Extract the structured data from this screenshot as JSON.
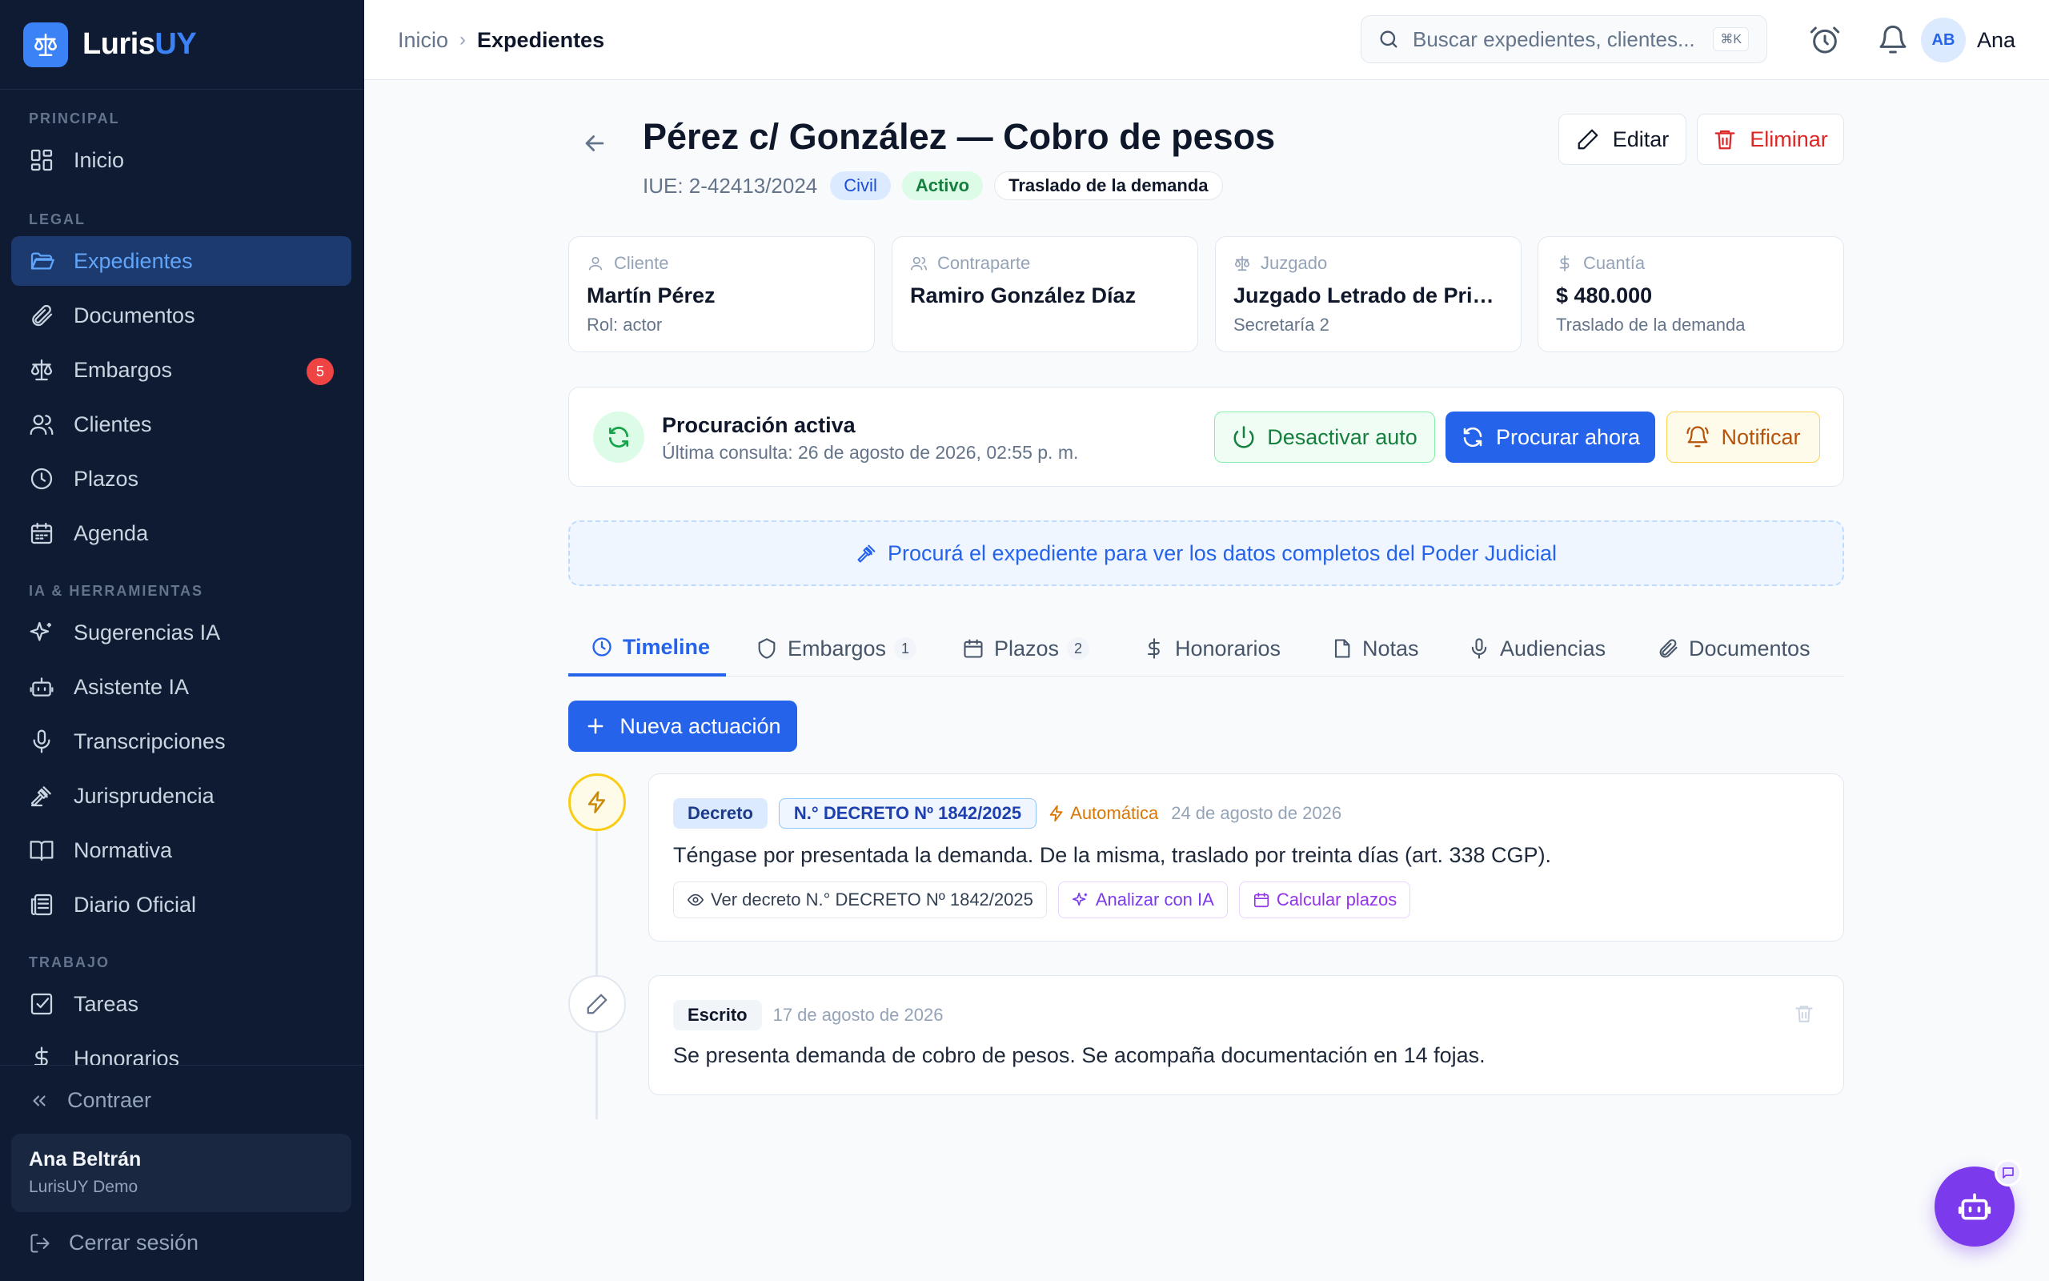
{
  "app": {
    "name_main": "Luris",
    "name_accent": "UY",
    "accent_color": "#3b82f6",
    "sidebar_bg": "#0f1b33"
  },
  "sidebar": {
    "sections": {
      "principal": "PRINCIPAL",
      "legal": "LEGAL",
      "ia": "IA & HERRAMIENTAS",
      "trabajo": "TRABAJO"
    },
    "items": {
      "inicio": "Inicio",
      "expedientes": "Expedientes",
      "documentos": "Documentos",
      "embargos": "Embargos",
      "embargos_badge": "5",
      "clientes": "Clientes",
      "plazos": "Plazos",
      "agenda": "Agenda",
      "sugerencias": "Sugerencias IA",
      "asistente": "Asistente IA",
      "transcripciones": "Transcripciones",
      "jurisprudencia": "Jurisprudencia",
      "normativa": "Normativa",
      "diario": "Diario Oficial",
      "tareas": "Tareas",
      "honorarios": "Honorarios"
    },
    "collapse_label": "Contraer",
    "user": {
      "name": "Ana Beltrán",
      "org": "LurisUY Demo"
    },
    "logout_label": "Cerrar sesión"
  },
  "topbar": {
    "breadcrumb": [
      "Inicio",
      "Expedientes"
    ],
    "search_placeholder": "Buscar expedientes, clientes...",
    "search_shortcut": "⌘K",
    "avatar_initials": "AB",
    "user_name": "Ana"
  },
  "case": {
    "title": "Pérez c/ González — Cobro de pesos",
    "iue": "IUE: 2-42413/2024",
    "materia": "Civil",
    "status": "Activo",
    "etapa": "Traslado de la demanda",
    "edit_label": "Editar",
    "delete_label": "Eliminar"
  },
  "info_cards": {
    "cliente": {
      "label": "Cliente",
      "value": "Martín Pérez",
      "sub": "Rol: actor"
    },
    "contraparte": {
      "label": "Contraparte",
      "value": "Ramiro González Díaz",
      "sub": ""
    },
    "juzgado": {
      "label": "Juzgado",
      "value": "Juzgado Letrado de Prime...",
      "sub": "Secretaría 2"
    },
    "cuantia": {
      "label": "Cuantía",
      "value": "$ 480.000",
      "sub": "Traslado de la demanda"
    }
  },
  "procuracion": {
    "title": "Procuración activa",
    "last_check": "Última consulta: 26 de agosto de 2026, 02:55 p. m.",
    "deactivate_label": "Desactivar auto",
    "procure_label": "Procurar ahora",
    "notify_label": "Notificar"
  },
  "hint": "Procurá el expediente para ver los datos completos del Poder Judicial",
  "tabs": {
    "timeline": "Timeline",
    "embargos": "Embargos",
    "embargos_count": "1",
    "plazos": "Plazos",
    "plazos_count": "2",
    "honorarios": "Honorarios",
    "notas": "Notas",
    "audiencias": "Audiencias",
    "documentos": "Documentos"
  },
  "new_action_label": "Nueva actuación",
  "actuaciones": [
    {
      "type": "Decreto",
      "number": "N.° DECRETO Nº 1842/2025",
      "origin": "Automática",
      "date": "24 de agosto de 2026",
      "text": "Téngase por presentada la demanda. De la misma, traslado por treinta días (art. 338 CGP).",
      "view_label": "Ver decreto N.° DECRETO Nº 1842/2025",
      "ia_label": "Analizar con IA",
      "plazos_label": "Calcular plazos"
    },
    {
      "type": "Escrito",
      "date": "17 de agosto de 2026",
      "text": "Se presenta demanda de cobro de pesos. Se acompaña documentación en 14 fojas."
    }
  ]
}
